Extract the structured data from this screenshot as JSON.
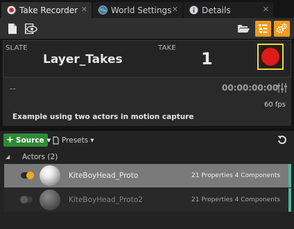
{
  "tabs": [
    {
      "label": "Take Recorder",
      "icon": "take-recorder-icon",
      "active": true
    },
    {
      "label": "World Settings",
      "icon": "globe-icon",
      "active": false
    },
    {
      "label": "Details",
      "icon": "info-icon",
      "active": false
    }
  ],
  "toolbar": {
    "left_icons": [
      "new-file-icon",
      "review-icon"
    ],
    "right_icons": [
      "open-folder-icon",
      "list-settings-icon",
      "gears-icon"
    ]
  },
  "slate": {
    "slate_label": "SLATE",
    "slate_value": "Layer_Takes",
    "take_label": "TAKE",
    "take_value": "1",
    "status": "--",
    "timecode": "00:00:00:00",
    "fps": "60 fps",
    "description": "Example using two actors in motion capture"
  },
  "sources_toolbar": {
    "source_button": "Source",
    "presets_button": "Presets"
  },
  "actors": {
    "header": "Actors (2)",
    "items": [
      {
        "name": "KiteBoyHead_Proto",
        "info": "21 Properties 4 Components",
        "enabled": true,
        "selected": true
      },
      {
        "name": "KiteBoyHead_Proto2",
        "info": "21 Properties 4 Components",
        "enabled": false,
        "selected": false
      }
    ]
  },
  "colors": {
    "accent_orange": "#f19b1f",
    "record_red": "#dd1b1b",
    "record_border": "#f0d83a",
    "source_green": "#2e8b35",
    "row_accent": "#4fb59d"
  }
}
